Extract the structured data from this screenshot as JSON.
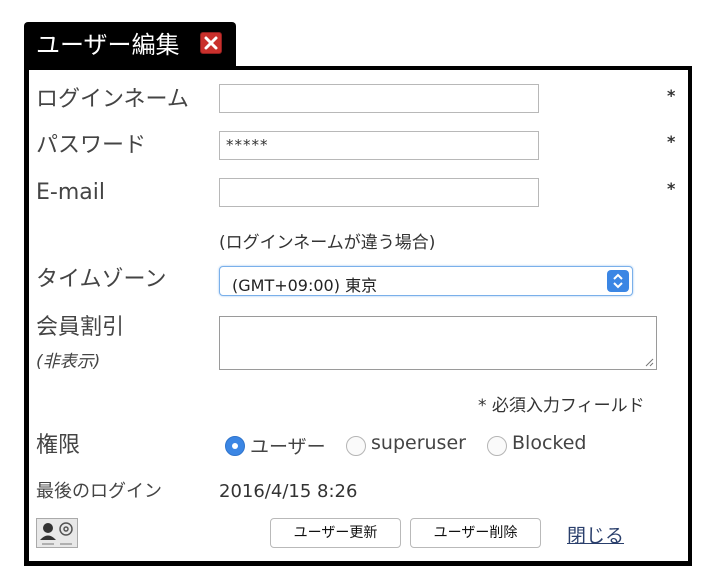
{
  "dialog": {
    "title": "ユーザー編集",
    "close_icon": "close-icon",
    "accent": "#3b86e4"
  },
  "form": {
    "login_label": "ログインネーム",
    "login_value": "",
    "login_required": "*",
    "password_label": "パスワード",
    "password_value": "*****",
    "password_required": "*",
    "email_label": "E-mail",
    "email_value": "",
    "email_required": "*",
    "email_hint": "(ログインネームが違う場合)",
    "timezone_label": "タイムゾーン",
    "timezone_value": "(GMT+09:00) 東京",
    "discount_label": "会員割引",
    "discount_sublabel": "(非表示)",
    "discount_value": "",
    "required_note": "* 必須入力フィールド",
    "role_label": "権限",
    "roles": [
      {
        "label": "ユーザー",
        "selected": true
      },
      {
        "label": "superuser",
        "selected": false
      },
      {
        "label": "Blocked",
        "selected": false
      }
    ],
    "last_login_label": "最後のログイン",
    "last_login_value": "2016/4/15 8:26"
  },
  "footer": {
    "avatar_icon": "user-card-icon",
    "update_label": "ユーザー更新",
    "delete_label": "ユーザー削除",
    "close_label": "閉じる"
  }
}
